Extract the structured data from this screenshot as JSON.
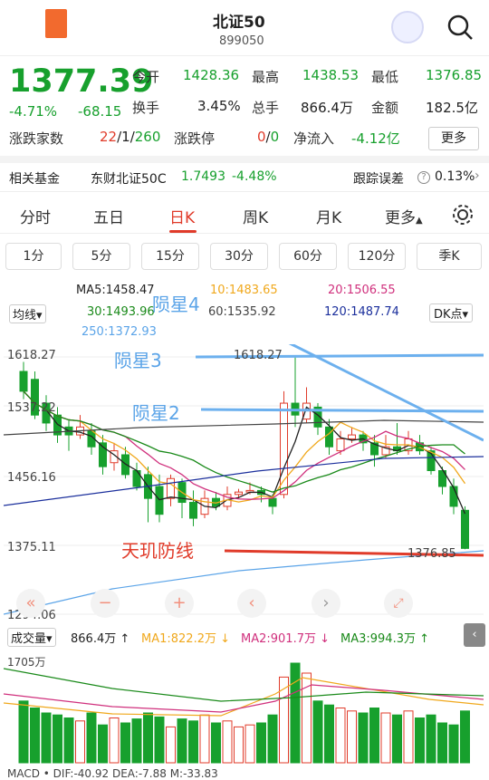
{
  "header": {
    "title": "北证50",
    "code": "899050"
  },
  "quote": {
    "price": "1377.39",
    "change_pct": "-4.71%",
    "change": "-68.15",
    "open_label": "今开",
    "open": "1428.36",
    "high_label": "最高",
    "high": "1438.53",
    "low_label": "最低",
    "low": "1376.85",
    "turnover_label": "换手",
    "turnover": "3.45%",
    "volume_label": "总手",
    "volume": "866.4万",
    "amount_label": "金额",
    "amount": "182.5亿",
    "breadth_label": "涨跌家数",
    "breadth_up": "22",
    "breadth_flat": "1",
    "breadth_down": "260",
    "limit_label": "涨跌停",
    "limit_up": "0",
    "limit_down": "0",
    "flow_label": "净流入",
    "flow": "-4.12亿",
    "more": "更多"
  },
  "fund": {
    "label": "相关基金",
    "name": "东财北证50C",
    "nav": "1.7493",
    "pct": "-4.48%",
    "track_label": "跟踪误差",
    "track": "0.13%"
  },
  "tabs": [
    "分时",
    "五日",
    "日K",
    "周K",
    "月K",
    "更多"
  ],
  "periods": [
    "1分",
    "5分",
    "15分",
    "30分",
    "60分",
    "120分",
    "季K"
  ],
  "ma": {
    "indicator": "均线",
    "ma5": "MA5:1458.47",
    "ma10": "10:1483.65",
    "ma20": "20:1506.55",
    "ma30": "30:1493.96",
    "ma60": "60:1535.92",
    "ma120": "120:1487.74",
    "ma250": "250:1372.93",
    "dk": "DK点"
  },
  "axis": {
    "p1": "1618.27",
    "p2": "1537.22",
    "p3": "1456.16",
    "p4": "1375.11",
    "p5": "1294.06",
    "high_mark": "1618.27",
    "low_mark": "1376.85"
  },
  "annotations": {
    "a4": "陨星4",
    "a3": "陨星3",
    "a2": "陨星2",
    "defense": "天玑防线"
  },
  "vol": {
    "label": "成交量",
    "value": "866.4万",
    "ma1": "MA1:822.2万",
    "ma2": "MA2:901.7万",
    "ma3": "MA3:994.3万",
    "max": "1705万"
  },
  "macd": {
    "text": "MACD • DIF:-40.92 DEA:-7.88 M:-33.83"
  },
  "colors": {
    "up": "#e03b2a",
    "down": "#17a02d",
    "ma5": "#222222",
    "ma10": "#f0a81c",
    "ma20": "#d0307d",
    "ma30": "#1a8a1a",
    "ma60": "#444444",
    "ma120": "#1b2f9c",
    "ma250": "#5ba4e8"
  }
}
